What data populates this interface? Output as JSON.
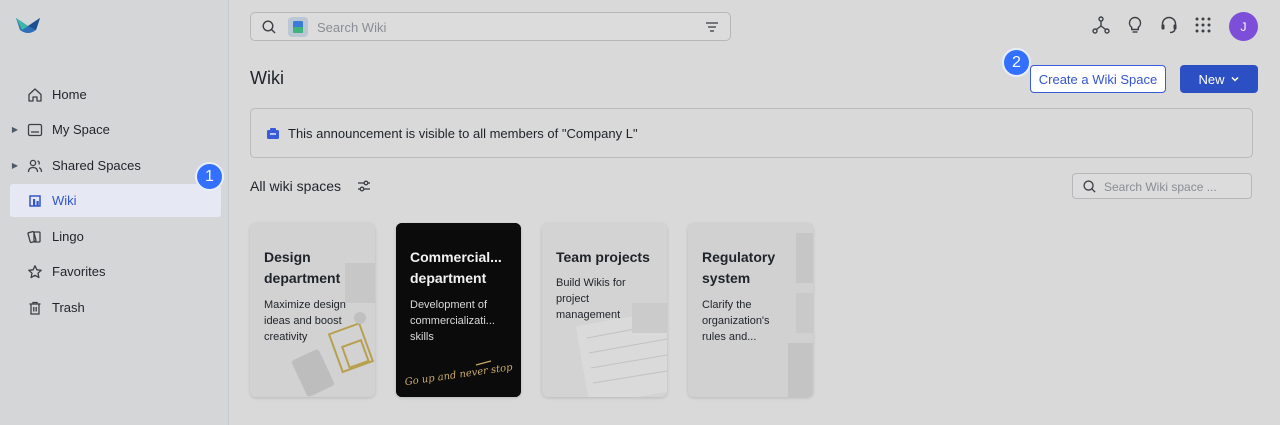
{
  "sidebar": {
    "items": [
      {
        "label": "Home",
        "icon": "home-icon",
        "expandable": false,
        "active": false
      },
      {
        "label": "My Space",
        "icon": "folder-icon",
        "expandable": true,
        "active": false
      },
      {
        "label": "Shared Spaces",
        "icon": "users-icon",
        "expandable": true,
        "active": false
      },
      {
        "label": "Wiki",
        "icon": "wiki-icon",
        "expandable": false,
        "active": true
      },
      {
        "label": "Lingo",
        "icon": "lingo-icon",
        "expandable": false,
        "active": false
      },
      {
        "label": "Favorites",
        "icon": "star-icon",
        "expandable": false,
        "active": false
      },
      {
        "label": "Trash",
        "icon": "trash-icon",
        "expandable": false,
        "active": false
      }
    ]
  },
  "annotations": {
    "marker1": "1",
    "marker2": "2"
  },
  "search": {
    "placeholder": "Search Wiki"
  },
  "topbar": {
    "icons": [
      "network-icon",
      "lightbulb-icon",
      "headset-icon",
      "apps-grid-icon"
    ],
    "avatar_initial": "J"
  },
  "header": {
    "title": "Wiki",
    "create_label": "Create a Wiki Space",
    "new_label": "New"
  },
  "announcement": {
    "text": "This announcement is visible to all members of \"Company L\""
  },
  "spaces": {
    "section_title": "All wiki spaces",
    "search_placeholder": "Search Wiki space ...",
    "cards": [
      {
        "title": "Design\ndepartment",
        "description": "Maximize design\nideas and boost\ncreativity"
      },
      {
        "title": "Commercial...\ndepartment",
        "description": "Development of\ncommercializati...\nskills",
        "image_text": "Go up and never stop"
      },
      {
        "title": "Team projects",
        "description": "Build Wikis for\nproject\nmanagement"
      },
      {
        "title": "Regulatory\nsystem",
        "description": "Clarify the\norganization's\nrules and..."
      }
    ]
  },
  "colors": {
    "accent": "#3370ff",
    "primary_button": "#2d4fc4",
    "avatar": "#7d4fd9"
  }
}
